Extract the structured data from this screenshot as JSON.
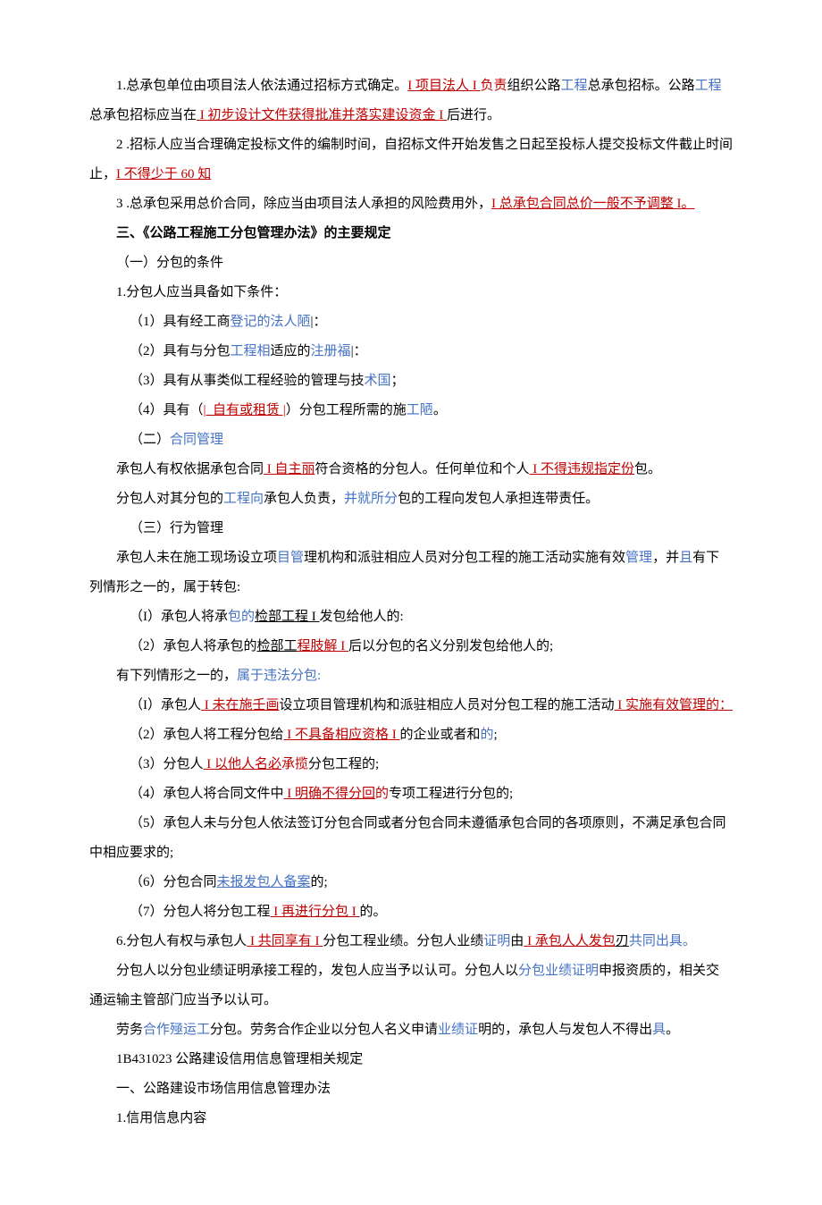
{
  "p1_a": "1.总承包单位由项目法人依法通过招标方式确定。",
  "p1_b": "I 项目法人 I ",
  "p1_c": "负责",
  "p1_d": "组织公路",
  "p1_e": "工程",
  "p1_f": "总承包招标。公路",
  "p1_g": "工程",
  "p1_h": "总承包招标应当在",
  "p1_i": " I 初步设计文件获得批准并落实建设资金 I ",
  "p1_j": "后进行。",
  "p2_a": "2 .招标人应当合理确定投标文件的编制时间，自招标文件开始发售之日起至投标人提交投标文件截止时间止，",
  "p2_b": "I 不得少于 60 知",
  "p3_a": "3     .总承包采用总价合同，除应当由项目法人承担的风险费用外，",
  "p3_b": "I 总承包合同总价一般不予调整 I。",
  "h3": "三、《公路工程施工分包管理办法》的主要规定",
  "s1": "（一）分包的条件",
  "p4": "1.分包人应当具备如下条件：",
  "p5_a": "（1）具有经工商",
  "p5_b": "登记的法人陋",
  "p5_c": "|：",
  "p6_a": "（2）具有与分包",
  "p6_b": "工程相",
  "p6_c": "适应的",
  "p6_d": "注册福",
  "p6_e": "|：",
  "p7_a": "（3）具有从事类似工程经验的管理与技",
  "p7_b": "术国",
  "p7_c": "；",
  "p8_a": "（4）具有（",
  "p8_b": "|_自有或租赁 |",
  "p8_c": "）分包工程所需的施",
  "p8_d": "工陋",
  "p8_e": "。",
  "s2_a": "（二）",
  "s2_b": "合同管理",
  "p9_a": "承包人有权依据承包合同",
  "p9_b": " I 自主丽",
  "p9_c": "符合资格的分包人。任何单位和个人",
  "p9_d": " I 不得违规指定份",
  "p9_e": "包。",
  "p10_a": "分包人对其分包的",
  "p10_b": "工程向",
  "p10_c": "承包人负责，",
  "p10_d": "并就所分",
  "p10_e": "包的工程向发包人承担连带责任。",
  "s3": "（三）行为管理",
  "p11_a": "承包人未在施工现场设立项",
  "p11_b": "目管",
  "p11_c": "理机构和派驻相应人员对分包工程的施工活动实施有效",
  "p11_d": "管理",
  "p11_e": "，并",
  "p11_f": "且",
  "p11_g": "有下列情形之一的，属于转包:",
  "p12_a": "（I）承包人将承",
  "p12_b": "包的",
  "p12_c": "检部工程 I ",
  "p12_d": "发包给他人的:",
  "p13_a": "（2）承包人将承包的",
  "p13_b": "检部工",
  "p13_c": "程肢解 I ",
  "p13_d": "后以分包的名义分别发包给他人的;",
  "p14_a": "有下列情形之一的，",
  "p14_b": "属于违法分包:",
  "p15_a": "（I）承包人",
  "p15_b": " I 未在施壬画",
  "p15_c": "设立项目管理机构和派驻相应人员对分包工程的施工活动",
  "p15_d": " I 实施有效管理的：",
  "p16_a": "（2）承包人将工程分包给",
  "p16_b": " I 不具备相应资格 I ",
  "p16_c": "的企业或者和",
  "p16_d": "的",
  "p16_e": ";",
  "p17_a": "（3）分包人",
  "p17_b": " I 以他人名必",
  "p17_c": "承揽",
  "p17_d": "分包工程的;",
  "p18_a": "（4）承包人将合同文件中",
  "p18_b": " I 明确不得分回",
  "p18_c": "的",
  "p18_d": "专项工程进行分包的;",
  "p19": "（5）承包人未与分包人依法签订分包合同或者分包合同未遵循承包合同的各项原则，不满足承包合同中相应要求的;",
  "p20_a": "（6）分包合同",
  "p20_b": "未报发包人备案",
  "p20_c": "的;",
  "p21_a": "（7）分包人将分包工程",
  "p21_b": " I 再进行分包 I ",
  "p21_c": "的。",
  "p22_a": "6.分包人有权与承包人",
  "p22_b": " I 共同享有 I ",
  "p22_c": "分包工程业绩。分包人业绩",
  "p22_d": "证明",
  "p22_e": "由",
  "p22_f": " I 承包人人发包",
  "p22_g": "刃",
  "p22_h": "共同出具。",
  "p23_a": "分包人以分包业绩证明承接工程的，发包人应当予以认可。分包人以",
  "p23_b": "分包业绩证明",
  "p23_c": "申报资质的，相关交通运输主管部门应当予以认可。",
  "p24_a": "劳务",
  "p24_b": "合作殛运工",
  "p24_c": "分包。劳务合作企业以分包人名义申请",
  "p24_d": "业绩证",
  "p24_e": "明的，承包人与发包人不得出",
  "p24_f": "具",
  "p24_g": "。",
  "p25": "1B431023 公路建设信用信息管理相关规定",
  "p26": "一、公路建设市场信用信息管理办法",
  "p27": "1.信用信息内容"
}
